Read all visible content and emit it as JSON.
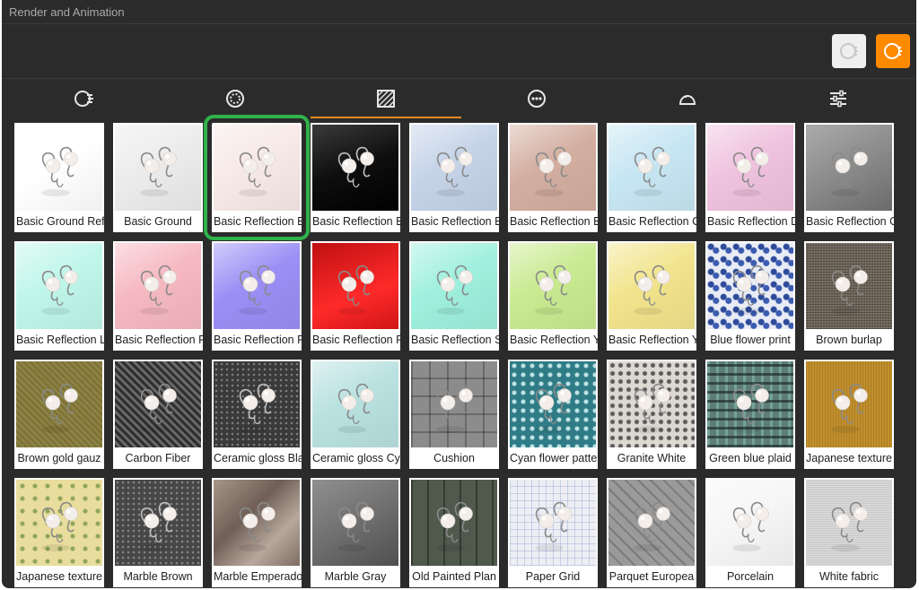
{
  "window": {
    "title": "Render and Animation"
  },
  "toolbar": {
    "buttons": [
      {
        "name": "render-preview-button",
        "icon": "render-sphere-icon"
      },
      {
        "name": "render-button",
        "icon": "render-sphere-icon",
        "color": "#ff8a00"
      }
    ]
  },
  "tabs": [
    {
      "name": "tab-render",
      "icon": "render-sphere-icon",
      "active": false
    },
    {
      "name": "tab-environment",
      "icon": "ring-icon",
      "active": false
    },
    {
      "name": "tab-backgrounds",
      "icon": "hatch-pattern-icon",
      "active": true
    },
    {
      "name": "tab-more",
      "icon": "ellipsis-icon",
      "active": false
    },
    {
      "name": "tab-lighting",
      "icon": "dome-icon",
      "active": false
    },
    {
      "name": "tab-settings",
      "icon": "sliders-icon",
      "active": false
    }
  ],
  "selected_index": 2,
  "backgrounds": [
    {
      "label": "Basic Ground Ref",
      "bg": "#ffffff",
      "style": "light"
    },
    {
      "label": "Basic Ground",
      "bg": "#ececec",
      "style": "light"
    },
    {
      "label": "Basic Reflection E",
      "bg": "#f7e9e6",
      "style": "light"
    },
    {
      "label": "Basic Reflection E",
      "bg": "#161616",
      "style": "dark"
    },
    {
      "label": "Basic Reflection E",
      "bg": "#c5d3e8",
      "style": "light"
    },
    {
      "label": "Basic Reflection E",
      "bg": "#d3aea0",
      "style": "light"
    },
    {
      "label": "Basic Reflection C",
      "bg": "#c7e6f3",
      "style": "light"
    },
    {
      "label": "Basic Reflection D",
      "bg": "#efc2df",
      "style": "light"
    },
    {
      "label": "Basic Reflection C",
      "bg": "#8f8f8f",
      "style": "gray"
    },
    {
      "label": "Basic Reflection L",
      "bg": "#bff6ea",
      "style": "light"
    },
    {
      "label": "Basic Reflection F",
      "bg": "#f6b8c1",
      "style": "light"
    },
    {
      "label": "Basic Reflection F",
      "bg": "#9b8ef5",
      "style": "light"
    },
    {
      "label": "Basic Reflection F",
      "bg": "#e91f22",
      "style": "red"
    },
    {
      "label": "Basic Reflection S",
      "bg": "#9ff0de",
      "style": "light"
    },
    {
      "label": "Basic Reflection Y",
      "bg": "#c9ea90",
      "style": "light"
    },
    {
      "label": "Basic Reflection Y",
      "bg": "#f2e48c",
      "style": "light"
    },
    {
      "label": "Blue flower print",
      "bg": "#e9ecf5",
      "style": "floral"
    },
    {
      "label": "Brown burlap",
      "bg": "#6d6458",
      "style": "burlap"
    },
    {
      "label": "Brown gold gauz",
      "bg": "#7f7434",
      "style": "gauze"
    },
    {
      "label": "Carbon Fiber",
      "bg": "#4a4a4a",
      "style": "carbon"
    },
    {
      "label": "Ceramic gloss Bla",
      "bg": "#3a3a3a",
      "style": "speckle"
    },
    {
      "label": "Ceramic gloss Cy",
      "bg": "#b8e1e0",
      "style": "light"
    },
    {
      "label": "Cushion",
      "bg": "#8c8c8c",
      "style": "cushion"
    },
    {
      "label": "Cyan flower patte",
      "bg": "#2f7c87",
      "style": "cyanflower"
    },
    {
      "label": "Granite White",
      "bg": "#dcd8d2",
      "style": "granite"
    },
    {
      "label": "Green blue plaid",
      "bg": "#5e7d77",
      "style": "plaid"
    },
    {
      "label": "Japanese texture",
      "bg": "#c28f2c",
      "style": "gold"
    },
    {
      "label": "Japanese texture",
      "bg": "#e8dd9c",
      "style": "jtex"
    },
    {
      "label": "Marble Brown",
      "bg": "#474747",
      "style": "speckle"
    },
    {
      "label": "Marble Emperado",
      "bg": "#8f7d72",
      "style": "marble"
    },
    {
      "label": "Marble Gray",
      "bg": "#6a6a6a",
      "style": "gray"
    },
    {
      "label": "Old Painted Plan",
      "bg": "#4f5a4d",
      "style": "planks"
    },
    {
      "label": "Paper Grid",
      "bg": "#eceef3",
      "style": "grid"
    },
    {
      "label": "Parquet Europea",
      "bg": "#9a9a9a",
      "style": "parquet"
    },
    {
      "label": "Porcelain",
      "bg": "#f6f6f6",
      "style": "light"
    },
    {
      "label": "White fabric",
      "bg": "#c9c9c9",
      "style": "fabric"
    }
  ]
}
